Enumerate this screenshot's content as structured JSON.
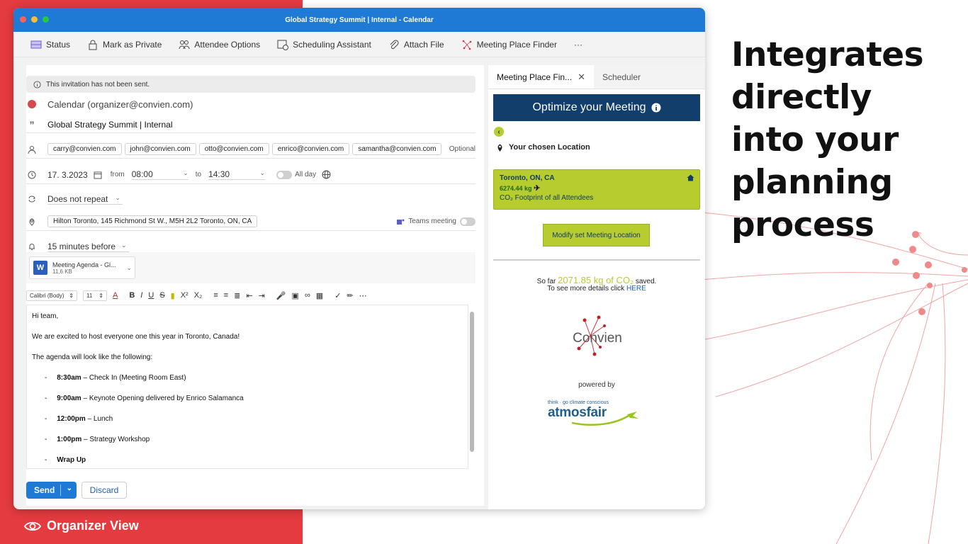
{
  "slide": {
    "headline_lines": [
      "Integrates",
      "directly",
      "into your",
      "planning",
      "process"
    ],
    "organizer_label": "Organizer View"
  },
  "window": {
    "title": "Global Strategy Summit | Internal - Calendar"
  },
  "toolbar": {
    "status": "Status",
    "mark_private": "Mark as Private",
    "attendee_options": "Attendee Options",
    "scheduling_assistant": "Scheduling Assistant",
    "attach_file": "Attach File",
    "meeting_place_finder": "Meeting Place Finder",
    "more": "···"
  },
  "form": {
    "banner": "This invitation has not been sent.",
    "calendar": "Calendar (organizer@convien.com)",
    "title": "Global Strategy Summit | Internal",
    "attendees": [
      "carry@convien.com",
      "john@convien.com",
      "otto@convien.com",
      "enrico@convien.com",
      "samantha@convien.com"
    ],
    "optional": "Optional",
    "date": "17.  3.2023",
    "from_label": "from",
    "from_time": "08:00",
    "to_label": "to",
    "to_time": "14:30",
    "all_day": "All day",
    "repeat": "Does not repeat",
    "location": "Hilton Toronto, 145 Richmond St W., M5H 2L2 Toronto, ON, CA",
    "teams": "Teams meeting",
    "reminder": "15 minutes before",
    "attachment_name": "Meeting Agenda - Gl...",
    "attachment_size": "11,6 KB"
  },
  "format_bar": {
    "font": "Calibri (Body)",
    "size": "11"
  },
  "body": {
    "greeting": "Hi team,",
    "intro": "We are excited to host everyone one this year in Toronto, Canada!",
    "agenda_intro": "The agenda will look like the following:",
    "items": [
      {
        "time": "8:30am",
        "desc": " – Check In (Meeting Room East)"
      },
      {
        "time": "9:00am",
        "desc": " – Keynote Opening delivered by Enrico Salamanca"
      },
      {
        "time": "12:00pm",
        "desc": " – Lunch"
      },
      {
        "time": "1:00pm",
        "desc": " – Strategy Workshop"
      },
      {
        "time": "Wrap Up",
        "desc": ""
      }
    ]
  },
  "actions": {
    "send": "Send",
    "discard": "Discard"
  },
  "panel": {
    "tab_active": "Meeting Place Fin...",
    "tab_other": "Scheduler",
    "optimize": "Optimize your Meeting",
    "chosen_location": "Your chosen Location",
    "location_name": "Toronto, ON, CA",
    "location_kg": "6274.44 kg",
    "footprint_label": "CO₂ Footprint of all Attendees",
    "modify_button": "Modify set Meeting Location",
    "saved_prefix": "So far",
    "saved_amount": "2071.85 kg of CO₂",
    "saved_suffix": "saved.",
    "details_prefix": "To see more details click",
    "details_link": "HERE",
    "logo_text": "Convien",
    "powered_by": "powered by",
    "atmosfair_tagline": "think · go climate conscious",
    "atmosfair_name": "atmosfair"
  },
  "colors": {
    "slide_red": "#e33b3f",
    "titlebar_blue": "#1f7ad6",
    "panel_navy": "#123e6b",
    "eco_green": "#b7cc2f"
  }
}
